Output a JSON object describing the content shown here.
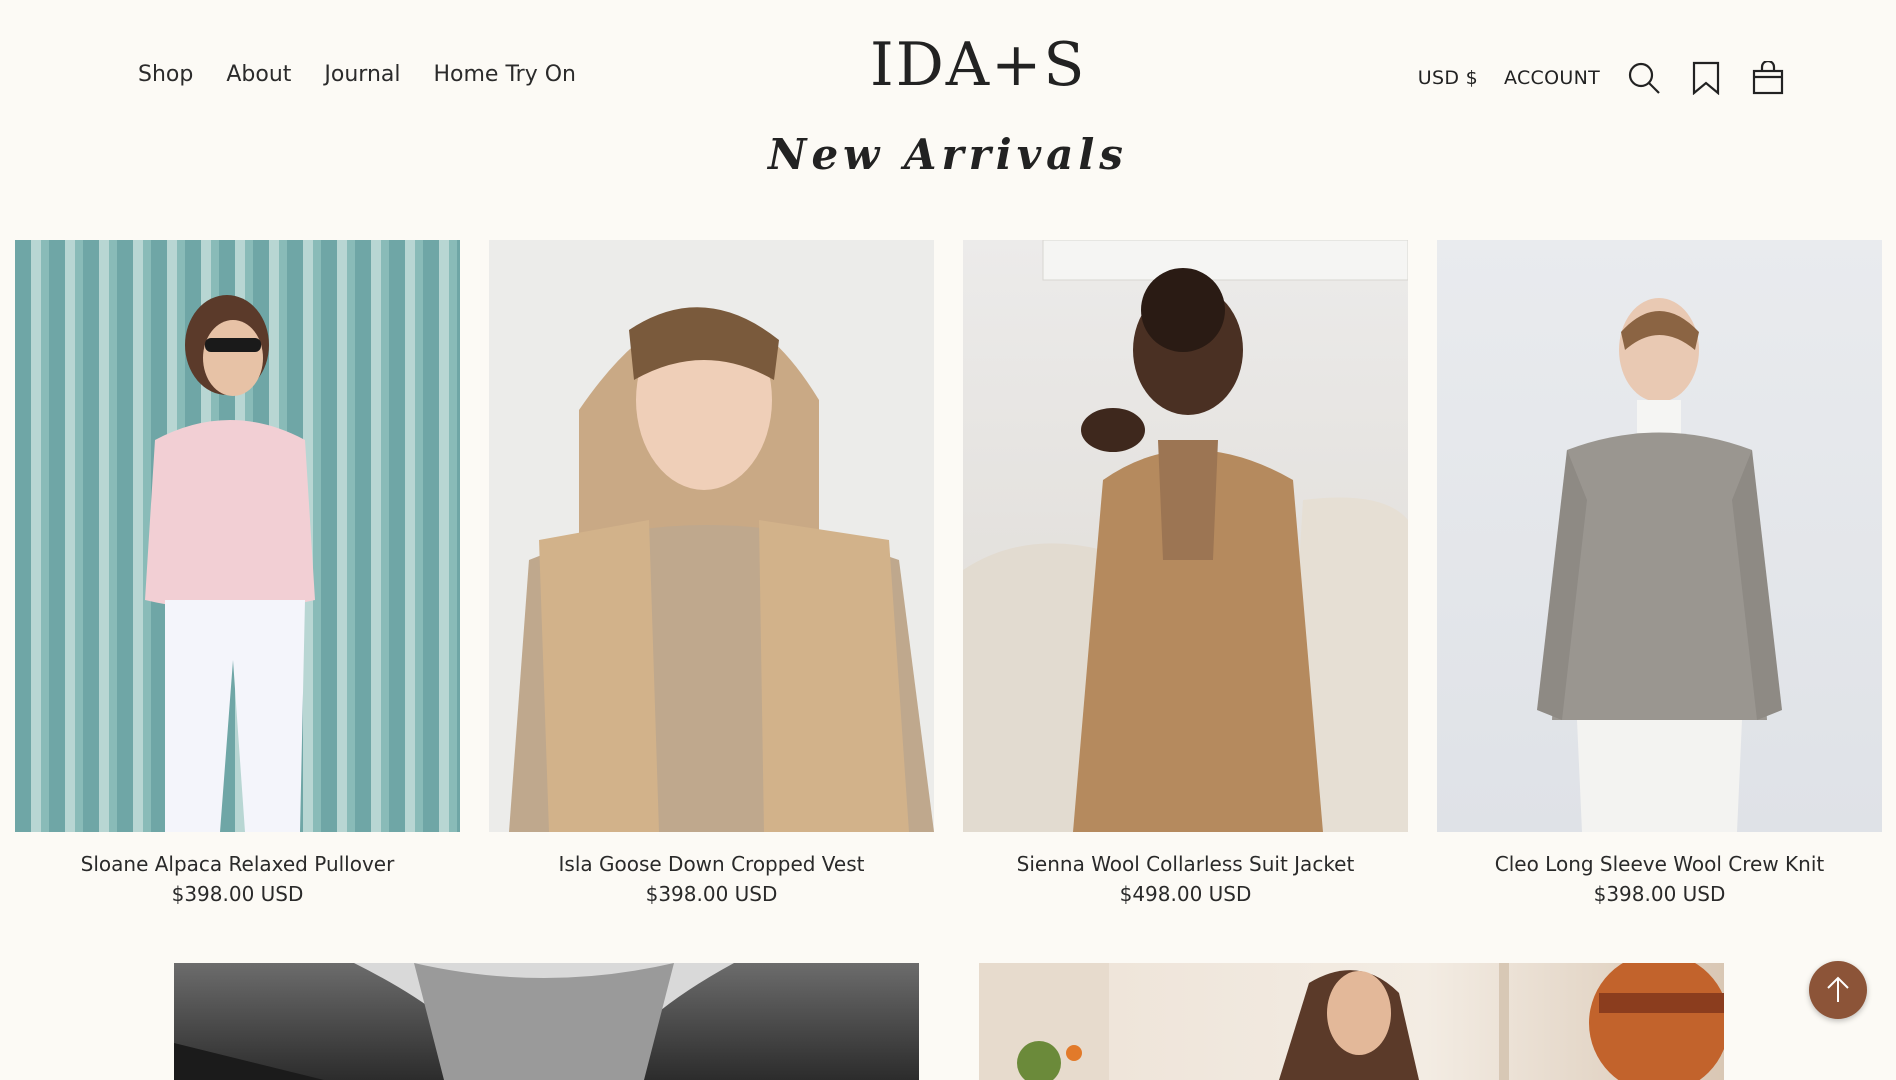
{
  "nav": {
    "items": [
      {
        "label": "Shop"
      },
      {
        "label": "About"
      },
      {
        "label": "Journal"
      },
      {
        "label": "Home Try On"
      }
    ]
  },
  "logo": {
    "text": "IDA+S"
  },
  "utility": {
    "currency": "USD $",
    "account": "ACCOUNT",
    "icons": [
      "search-icon",
      "bookmark-icon",
      "bag-icon"
    ]
  },
  "section": {
    "title": "New Arrivals"
  },
  "products": [
    {
      "name": "Sloane Alpaca Relaxed Pullover",
      "price": "$398.00 USD"
    },
    {
      "name": "Isla Goose Down Cropped Vest",
      "price": "$398.00 USD"
    },
    {
      "name": "Sienna Wool Collarless Suit Jacket",
      "price": "$498.00 USD"
    },
    {
      "name": "Cleo Long Sleeve Wool Crew Knit",
      "price": "$398.00 USD"
    }
  ],
  "colors": {
    "background": "#fcfaf5",
    "back_to_top": "#8c5438",
    "text": "#222222"
  }
}
